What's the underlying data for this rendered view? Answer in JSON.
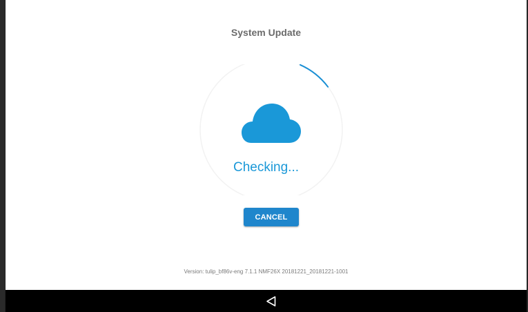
{
  "app": {
    "title": "System Update"
  },
  "update": {
    "status_text": "Checking...",
    "progress_fraction": 0.08,
    "cancel_label": "CANCEL",
    "version_text": "Version: tulip_bf86v-eng 7.1.1 NMF26X 20181221_20181221-1001"
  },
  "icons": {
    "status_icon": "cloud-icon",
    "nav_back": "back-triangle-icon"
  },
  "colors": {
    "accent": "#1a98d8",
    "button": "#1f86cc",
    "title": "#6b6b6b",
    "nav_bar": "#000000"
  }
}
